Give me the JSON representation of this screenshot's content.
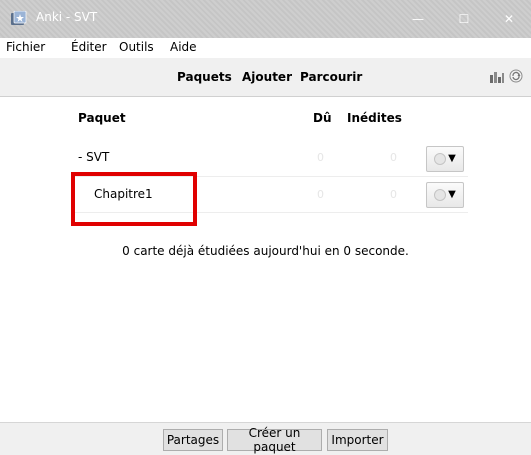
{
  "window": {
    "title": "Anki - SVT",
    "controls": {
      "minimize": "—",
      "maximize": "☐",
      "close": "✕"
    }
  },
  "menu": [
    "Fichier",
    "Éditer",
    "Outils",
    "Aide"
  ],
  "toolbar": {
    "links": [
      "Paquets",
      "Ajouter",
      "Parcourir"
    ],
    "icons": [
      "stats-icon",
      "sync-icon"
    ]
  },
  "deck_table": {
    "headers": {
      "deck": "Paquet",
      "due": "Dû",
      "new": "Inédites"
    },
    "rows": [
      {
        "name": "- SVT",
        "due": "0",
        "new": "0"
      },
      {
        "name": "Chapitre1",
        "due": "0",
        "new": "0"
      }
    ]
  },
  "studied_text": "0 carte déjà étudiées aujourd'hui en 0 seconde.",
  "bottom_buttons": [
    "Partages",
    "Créer un paquet",
    "Importer"
  ],
  "colors": {
    "highlight": "#e00000",
    "titlebar": "#c9c9c9",
    "toolbar_bg": "#f0f0f0"
  }
}
